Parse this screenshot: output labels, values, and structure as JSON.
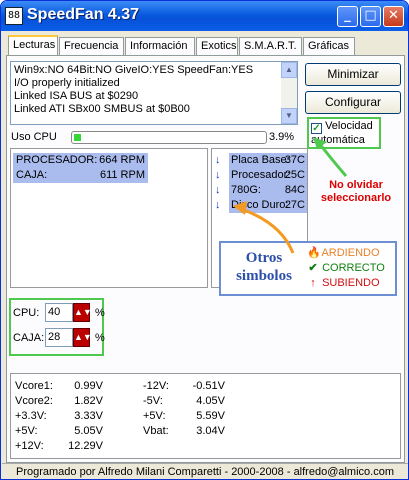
{
  "window": {
    "title": "SpeedFan 4.37",
    "icon_text": "88"
  },
  "tabs": [
    {
      "label": "Lecturas",
      "active": true
    },
    {
      "label": "Frecuencia"
    },
    {
      "label": "Información"
    },
    {
      "label": "Exotics"
    },
    {
      "label": "S.M.A.R.T."
    },
    {
      "label": "Gráficas"
    }
  ],
  "log": {
    "lines": [
      "Win9x:NO  64Bit:NO  GiveIO:YES  SpeedFan:YES",
      "I/O properly initialized",
      "Linked ISA BUS at $0290",
      "Linked ATI SBx00 SMBUS at $0B00"
    ]
  },
  "buttons": {
    "minimize": "Minimizar",
    "configure": "Configurar"
  },
  "cpu_usage": {
    "label": "Uso CPU",
    "value_text": "3.9%",
    "value": 3.9
  },
  "auto_speed": {
    "label_line1": "Velocidad",
    "label_line2": "automática",
    "checked": true,
    "check_glyph": "✓"
  },
  "fans": [
    {
      "name": "PROCESADOR:",
      "value": "664 RPM"
    },
    {
      "name": "CAJA:",
      "value": "611 RPM"
    }
  ],
  "temps": [
    {
      "arrow": "↓",
      "name": "Placa Base:",
      "value": "37C"
    },
    {
      "arrow": "↓",
      "name": "Procesador:",
      "value": "25C"
    },
    {
      "arrow": "↓",
      "name": "780G:",
      "value": "84C"
    },
    {
      "arrow": "↓",
      "name": "Disco Duro:",
      "value": "27C"
    }
  ],
  "annotation": {
    "line1": "No olvidar",
    "line2": "seleccionarlo"
  },
  "legend": {
    "title_line1": "Otros",
    "title_line2": "simbolos",
    "items": [
      {
        "icon": "🔥",
        "label": "ARDIENDO",
        "color": "#e8822a"
      },
      {
        "icon": "✔",
        "label": "CORRECTO",
        "color": "#108010"
      },
      {
        "icon": "↑",
        "label": "SUBIENDO",
        "color": "#d01010"
      }
    ]
  },
  "speed_limits": [
    {
      "label": "CPU:",
      "value": "40",
      "unit": "%"
    },
    {
      "label": "CAJA:",
      "value": "28",
      "unit": "%"
    }
  ],
  "voltages": {
    "left": [
      {
        "name": "Vcore1:",
        "value": "0.99V"
      },
      {
        "name": "Vcore2:",
        "value": "1.82V"
      },
      {
        "name": "+3.3V:",
        "value": "3.33V"
      },
      {
        "name": "+5V:",
        "value": "5.05V"
      },
      {
        "name": "+12V:",
        "value": "12.29V"
      }
    ],
    "right": [
      {
        "name": "-12V:",
        "value": "-0.51V"
      },
      {
        "name": "-5V:",
        "value": "4.05V"
      },
      {
        "name": "+5V:",
        "value": "5.59V"
      },
      {
        "name": "Vbat:",
        "value": "3.04V"
      }
    ]
  },
  "status_bar": "Programado por Alfredo Milani Comparetti - 2000-2008 - alfredo@almico.com",
  "colors": {
    "title_bar": "#0a5ae0",
    "highlight": "#aabbee",
    "annotation_green": "#4ec94e",
    "arrow_orange": "#f39a22",
    "red": "#dd0000"
  }
}
